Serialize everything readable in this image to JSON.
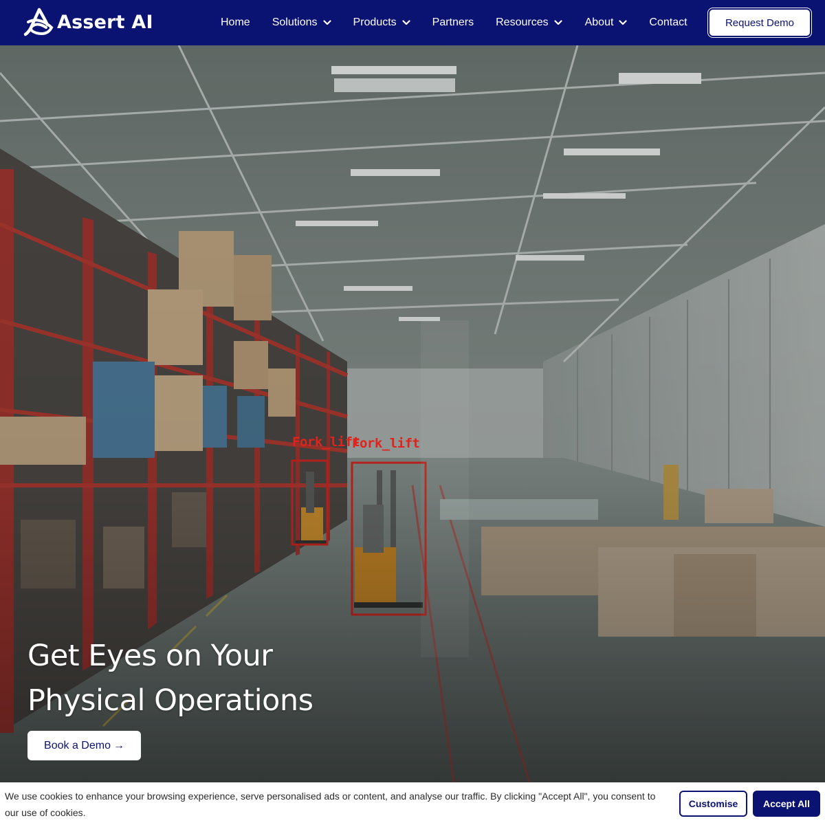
{
  "brand": {
    "name": "Assert AI",
    "logo_icon": "assert-ai-logo-icon",
    "primary_color": "#0b1372",
    "detection_color": "#e0231c"
  },
  "nav": {
    "items": [
      {
        "label": "Home",
        "has_dropdown": false
      },
      {
        "label": "Solutions",
        "has_dropdown": true
      },
      {
        "label": "Products",
        "has_dropdown": true
      },
      {
        "label": "Partners",
        "has_dropdown": false
      },
      {
        "label": "Resources",
        "has_dropdown": true
      },
      {
        "label": "About",
        "has_dropdown": true
      },
      {
        "label": "Contact",
        "has_dropdown": false
      }
    ],
    "cta_label": "Request Demo"
  },
  "hero": {
    "title_line1": "Get Eyes on Your",
    "title_line2": "Physical Operations",
    "cta_label": "Book a Demo",
    "cta_arrow": "→",
    "detections": [
      {
        "label": "Fork_lift"
      },
      {
        "label": "Fork_lift"
      }
    ]
  },
  "cookie": {
    "text": "We use cookies to enhance your browsing experience, serve personalised ads or content, and analyse our traffic. By clicking \"Accept All\", you consent to our use of cookies.",
    "customise_label": "Customise",
    "accept_label": "Accept All"
  }
}
